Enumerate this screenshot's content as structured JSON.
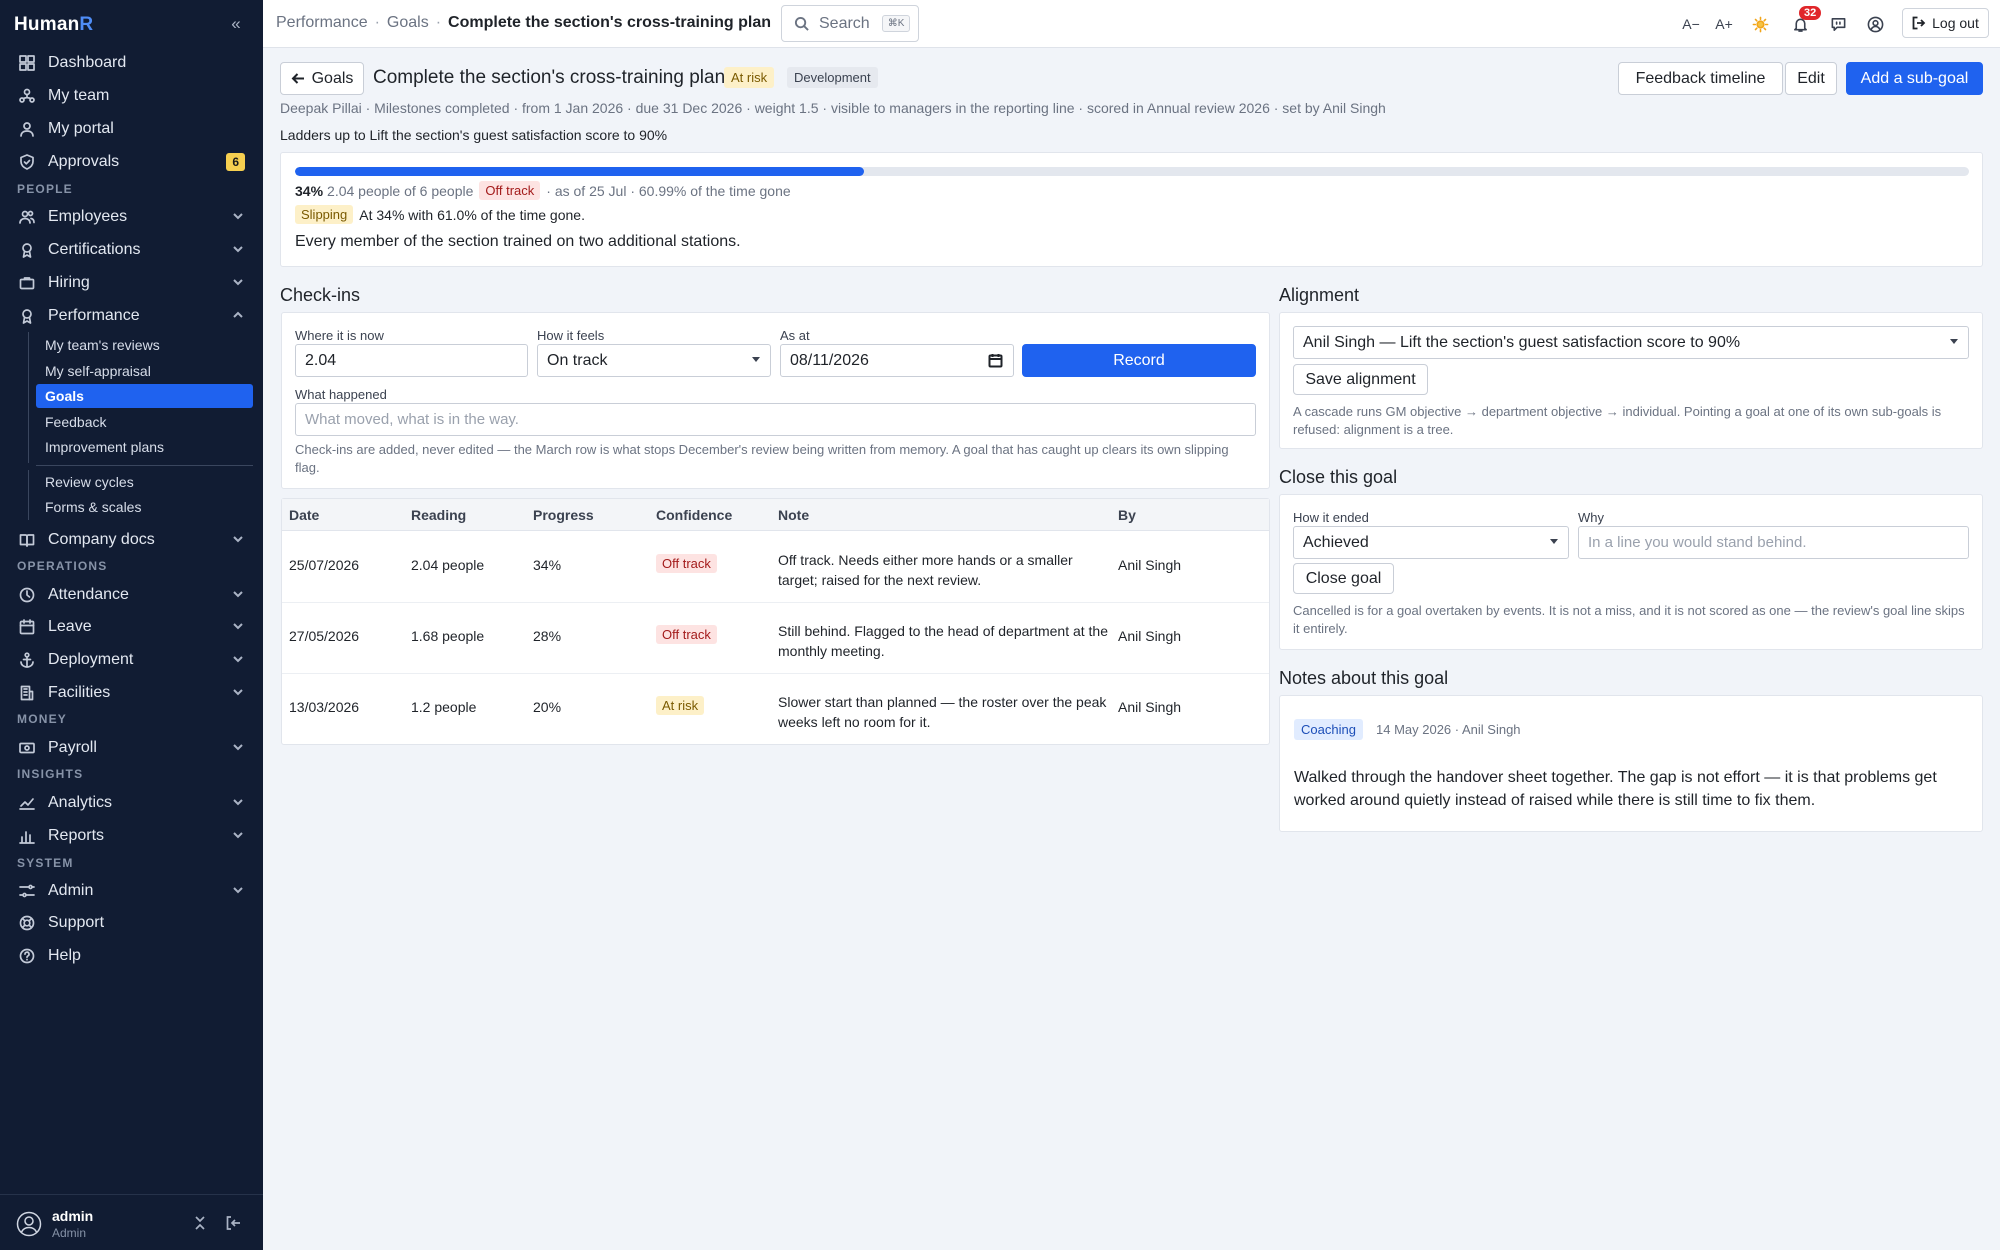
{
  "app": {
    "brand_main": "Human",
    "brand_accent": "R",
    "accent_color": "#1f62ef"
  },
  "sidebar": {
    "items_top": [
      {
        "label": "Dashboard",
        "icon": "grid-icon"
      },
      {
        "label": "My team",
        "icon": "team-icon"
      },
      {
        "label": "My portal",
        "icon": "person-icon"
      },
      {
        "label": "Approvals",
        "icon": "shield-check-icon",
        "badge": "6"
      }
    ],
    "section_people": "PEOPLE",
    "people": [
      {
        "label": "Employees",
        "icon": "people-icon"
      },
      {
        "label": "Certifications",
        "icon": "award-icon"
      },
      {
        "label": "Hiring",
        "icon": "briefcase-icon"
      },
      {
        "label": "Performance",
        "icon": "medal-icon"
      }
    ],
    "performance_sub": [
      "My team's reviews",
      "My self-appraisal",
      "Goals",
      "Feedback",
      "Improvement plans"
    ],
    "performance_sub2": [
      "Review cycles",
      "Forms & scales"
    ],
    "company_docs": "Company docs",
    "section_operations": "OPERATIONS",
    "operations": [
      {
        "label": "Attendance",
        "icon": "clock-icon"
      },
      {
        "label": "Leave",
        "icon": "calendar-icon"
      },
      {
        "label": "Deployment",
        "icon": "anchor-icon"
      },
      {
        "label": "Facilities",
        "icon": "building-icon"
      }
    ],
    "section_money": "MONEY",
    "payroll": "Payroll",
    "section_insights": "INSIGHTS",
    "insights": [
      {
        "label": "Analytics",
        "icon": "chart-line-icon"
      },
      {
        "label": "Reports",
        "icon": "bar-chart-icon"
      }
    ],
    "section_system": "SYSTEM",
    "admin": "Admin",
    "support": "Support",
    "help": "Help",
    "user_name": "admin",
    "user_role": "Admin"
  },
  "topbar": {
    "crumb_1": "Performance",
    "crumb_2": "Goals",
    "crumb_current": "Complete the section's cross-training plan",
    "search_label": "Search",
    "search_kbd": "⌘K",
    "font_smaller": "A−",
    "font_larger": "A+",
    "notif_count": "32",
    "logout": "Log out"
  },
  "header": {
    "back_label": "Goals",
    "title": "Complete the section's cross-training plan",
    "status_tag": "At risk",
    "category_tag": "Development",
    "meta": "Deepak Pillai · Milestones completed · from 1 Jan 2026 · due 31 Dec 2026 · weight 1.5 · visible to managers in the reporting line · scored in Annual review 2026 · set by Anil Singh",
    "ladder": "Ladders up to Lift the section's guest satisfaction score to 90%",
    "btn_timeline": "Feedback timeline",
    "btn_edit": "Edit",
    "btn_subgoal": "Add a sub-goal"
  },
  "progress": {
    "fraction": 0.34,
    "percent": "34%",
    "detail": "2.04 people of 6 people",
    "status": "Off track",
    "asof": "· as of 25 Jul · 60.99% of the time gone",
    "slip_tag": "Slipping",
    "slip_text": "At 34% with 61.0% of the time gone.",
    "description": "Every member of the section trained on two additional stations."
  },
  "checkins": {
    "heading": "Check-ins",
    "where_label": "Where it is now",
    "where_value": "2.04",
    "feel_label": "How it feels",
    "feel_value": "On track",
    "asat_label": "As at",
    "asat_value": "08/11/2026",
    "record_btn": "Record",
    "happened_label": "What happened",
    "happened_placeholder": "What moved, what is in the way.",
    "help": "Check-ins are added, never edited — the March row is what stops December's review being written from memory. A goal that has caught up clears its own slipping flag.",
    "columns": [
      "Date",
      "Reading",
      "Progress",
      "Confidence",
      "Note",
      "By"
    ],
    "rows": [
      {
        "date": "25/07/2026",
        "reading": "2.04 people",
        "progress": "34%",
        "confidence": "Off track",
        "note": "Off track. Needs either more hands or a smaller target; raised for the next review.",
        "by": "Anil Singh"
      },
      {
        "date": "27/05/2026",
        "reading": "1.68 people",
        "progress": "28%",
        "confidence": "Off track",
        "note": "Still behind. Flagged to the head of department at the monthly meeting.",
        "by": "Anil Singh"
      },
      {
        "date": "13/03/2026",
        "reading": "1.2 people",
        "progress": "20%",
        "confidence": "At risk",
        "note": "Slower start than planned — the roster over the peak weeks left no room for it.",
        "by": "Anil Singh"
      }
    ]
  },
  "alignment": {
    "heading": "Alignment",
    "select_value": "Anil Singh — Lift the section's guest satisfaction score to 90%",
    "save_btn": "Save alignment",
    "help": "A cascade runs GM objective → department objective → individual. Pointing a goal at one of its own sub-goals is refused: alignment is a tree."
  },
  "close": {
    "heading": "Close this goal",
    "ended_label": "How it ended",
    "ended_value": "Achieved",
    "why_label": "Why",
    "why_placeholder": "In a line you would stand behind.",
    "close_btn": "Close goal",
    "help": "Cancelled is for a goal overtaken by events. It is not a miss, and it is not scored as one — the review's goal line skips it entirely."
  },
  "notes": {
    "heading": "Notes about this goal",
    "tag": "Coaching",
    "meta": "14 May 2026 · Anil Singh",
    "body": "Walked through the handover sheet together. The gap is not effort — it is that problems get worked around quietly instead of raised while there is still time to fix them."
  }
}
